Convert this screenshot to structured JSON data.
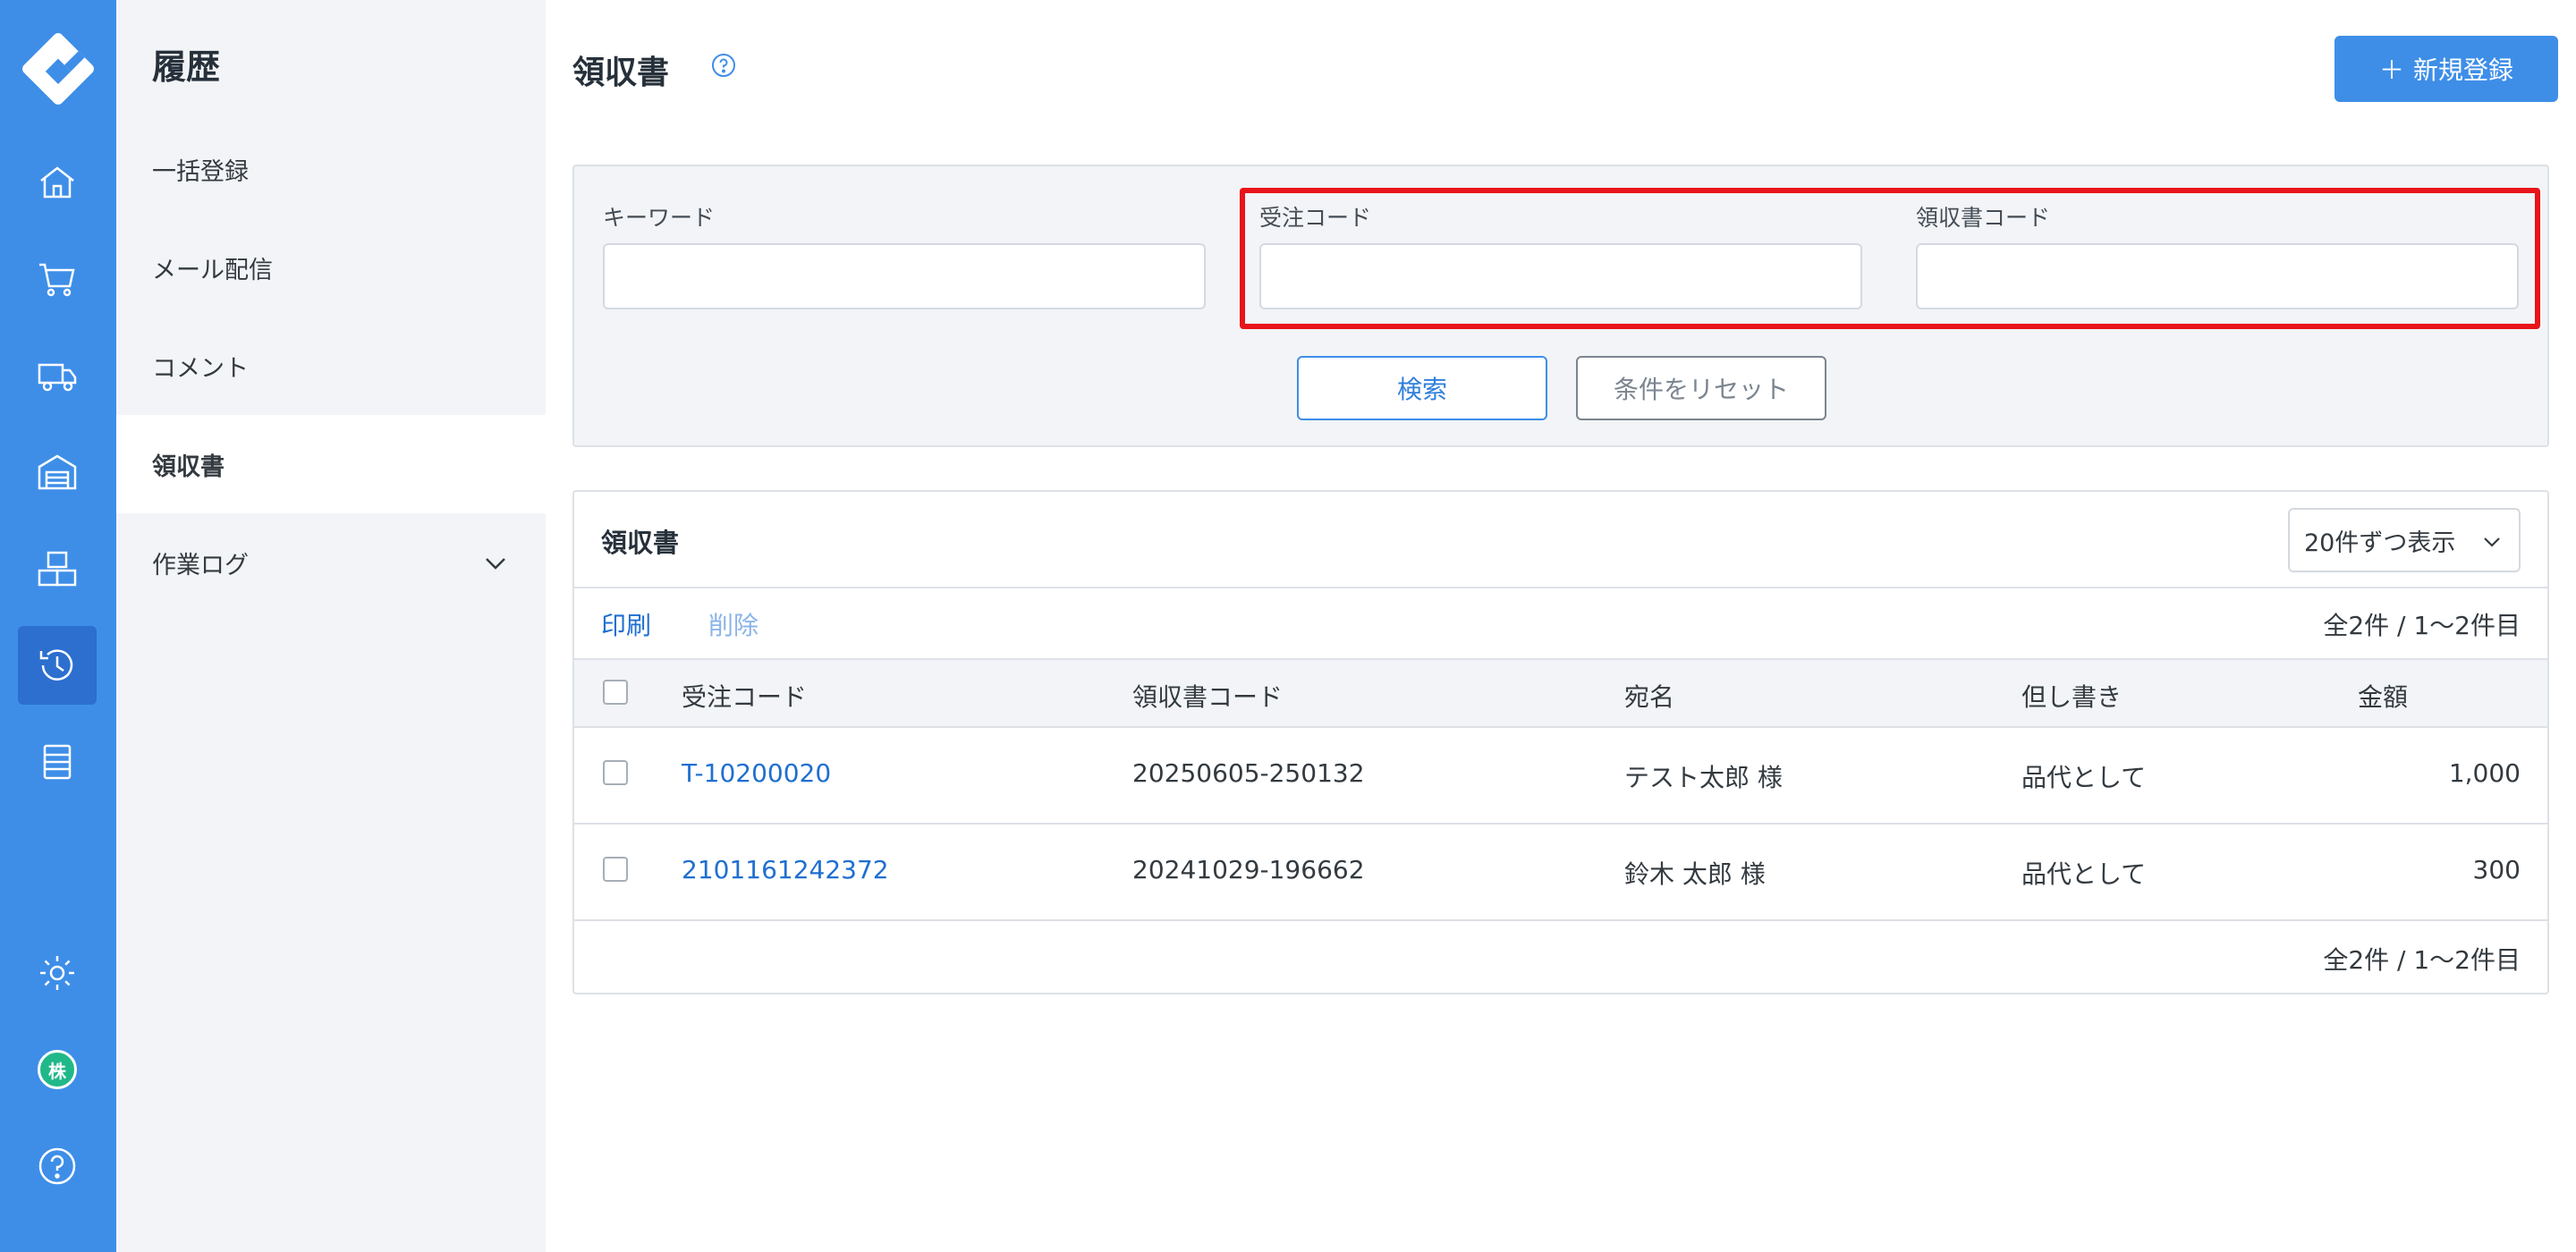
{
  "rail": {
    "icons": [
      "logo-icon",
      "home-icon",
      "cart-icon",
      "truck-icon",
      "warehouse-icon",
      "boxes-icon",
      "history-icon",
      "document-list-icon",
      "gear-icon",
      "company-badge-icon",
      "help-icon"
    ],
    "badge_text": "株",
    "accent": "#3e8ee8"
  },
  "submenu": {
    "heading": "履歴",
    "items": [
      {
        "label": "一括登録"
      },
      {
        "label": "メール配信"
      },
      {
        "label": "コメント"
      },
      {
        "label": "領収書",
        "active": true
      },
      {
        "label": "作業ログ",
        "expandable": true
      }
    ]
  },
  "page": {
    "title": "領収書",
    "new_button_icon": "＋",
    "new_button_label": "新規登録"
  },
  "search": {
    "keyword_label": "キーワード",
    "keyword_value": "",
    "order_code_label": "受注コード",
    "order_code_value": "",
    "receipt_code_label": "領収書コード",
    "receipt_code_value": "",
    "search_button": "検索",
    "reset_button": "条件をリセット"
  },
  "results": {
    "title": "領収書",
    "per_page": "20件ずつ表示",
    "print_link": "印刷",
    "delete_link": "削除",
    "count_top": "全2件 / 1〜2件目",
    "count_bottom": "全2件 / 1〜2件目",
    "columns": [
      "受注コード",
      "領収書コード",
      "宛名",
      "但し書き",
      "金額"
    ],
    "rows": [
      {
        "order_code": "T-10200020",
        "receipt_code": "20250605-250132",
        "recipient": "テスト太郎 様",
        "note": "品代として",
        "amount": "1,000"
      },
      {
        "order_code": "2101161242372",
        "receipt_code": "20241029-196662",
        "recipient": "鈴木 太郎 様",
        "note": "品代として",
        "amount": "300"
      }
    ]
  },
  "highlight": {
    "color": "#e8141a"
  }
}
